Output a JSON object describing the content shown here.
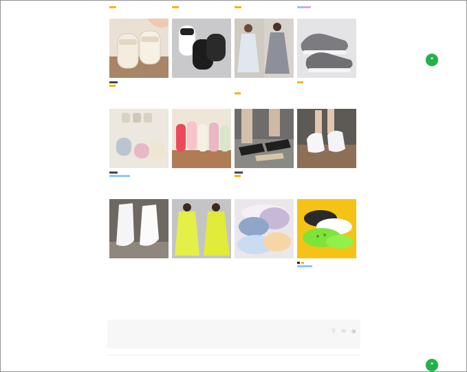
{
  "products": {
    "rows": [
      [
        {
          "name": "",
          "tags": [
            "yellow"
          ],
          "image": "beige-slides"
        },
        {
          "name": "",
          "tags": [],
          "image": "black-white-slides"
        },
        {
          "name": "",
          "tags": [
            "yellow"
          ],
          "image": "dress-models"
        },
        {
          "name": "",
          "tags": [
            "yellow"
          ],
          "image": "grey-sneakers"
        }
      ],
      [
        {
          "name": "",
          "tags": [
            "blue"
          ],
          "image": "slipper-display"
        },
        {
          "name": "",
          "tags": [],
          "image": "colorful-slippers"
        },
        {
          "name": "",
          "tags": [
            "yellow"
          ],
          "image": "strappy-sandals"
        },
        {
          "name": "",
          "tags": [],
          "image": "white-socks"
        }
      ],
      [
        {
          "name": "",
          "tags": [],
          "image": "white-boot-covers"
        },
        {
          "name": "",
          "tags": [],
          "image": "yellow-raincoats"
        },
        {
          "name": "",
          "tags": [],
          "image": "sun-visor-hats"
        },
        {
          "name": "",
          "tags": [
            "black",
            "blue"
          ],
          "image": "green-clogs"
        }
      ]
    ]
  },
  "footer": {
    "title": "",
    "paragraph1": "",
    "paragraph2": "",
    "copyright": "",
    "icons": [
      "weibo-icon",
      "wechat-icon",
      "globe-icon"
    ]
  },
  "colors": {
    "accent": "#f2b705",
    "chat": "#21b34a",
    "tag_blue": "#8ec5ff"
  }
}
